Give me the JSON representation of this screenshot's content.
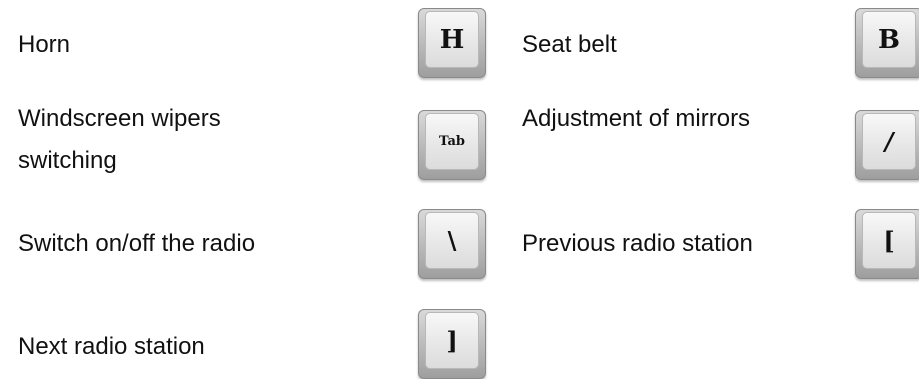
{
  "controls": [
    {
      "label": "Horn",
      "key": "H"
    },
    {
      "label": "Seat belt",
      "key": "B"
    },
    {
      "label_line1": "Windscreen wipers",
      "label_line2": "switching",
      "key": "Tab"
    },
    {
      "label": "Adjustment of mirrors",
      "key": "/"
    },
    {
      "label": "Switch on/off the radio",
      "key": "\\"
    },
    {
      "label": "Previous radio station",
      "key": "["
    },
    {
      "label": "Next radio station",
      "key": "]"
    }
  ]
}
